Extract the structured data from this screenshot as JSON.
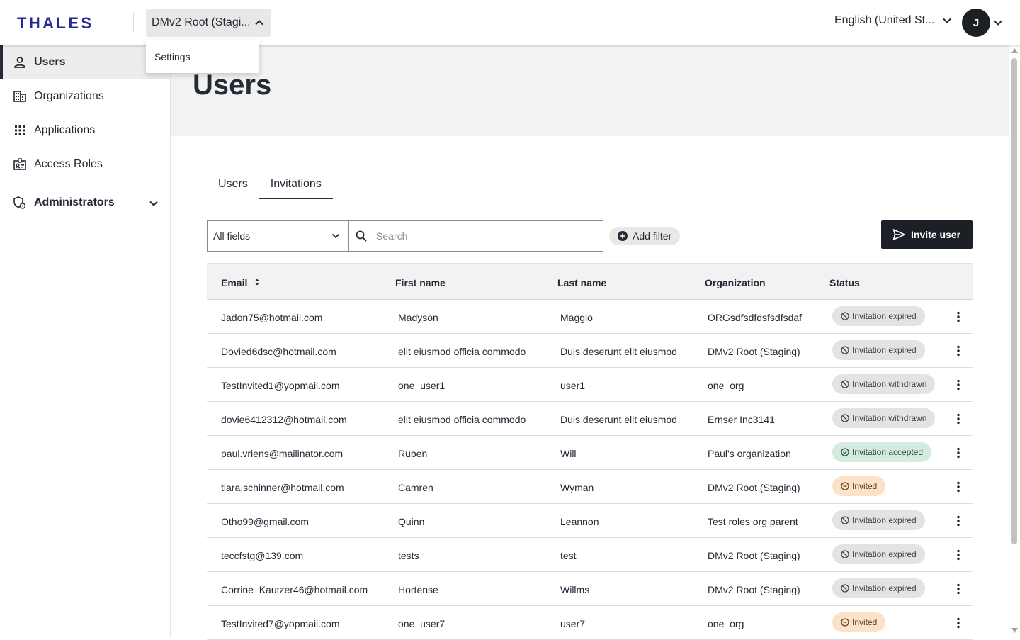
{
  "header": {
    "logo": "THALES",
    "org_selector": "DMv2 Root (Stagi...",
    "language": "English (United St...",
    "avatar_initial": "J"
  },
  "dropdown": {
    "items": [
      "Settings"
    ]
  },
  "sidebar": {
    "items": [
      {
        "label": "Users",
        "icon": "person-icon",
        "active": true
      },
      {
        "label": "Organizations",
        "icon": "building-icon"
      },
      {
        "label": "Applications",
        "icon": "apps-grid-icon"
      },
      {
        "label": "Access Roles",
        "icon": "id-badge-icon"
      },
      {
        "label": "Administrators",
        "icon": "admin-shield-icon",
        "expandable": true
      }
    ]
  },
  "main": {
    "title": "Users",
    "tabs": [
      {
        "label": "Users",
        "active": false
      },
      {
        "label": "Invitations",
        "active": true
      }
    ],
    "filter_field": "All fields",
    "search_placeholder": "Search",
    "add_filter": "Add filter",
    "invite_button": "Invite user"
  },
  "table": {
    "columns": [
      "Email",
      "First name",
      "Last name",
      "Organization",
      "Status"
    ],
    "rows": [
      {
        "email": "Jadon75@hotmail.com",
        "first": "Madyson",
        "last": "Maggio",
        "org": "ORGsdfsdfdsfsdfsdaf",
        "status": "Invitation expired",
        "kind": "expired"
      },
      {
        "email": "Dovied6dsc@hotmail.com",
        "first": "elit eiusmod officia commodo",
        "last": "Duis deserunt elit eiusmod",
        "org": "DMv2 Root (Staging)",
        "status": "Invitation expired",
        "kind": "expired"
      },
      {
        "email": "TestInvited1@yopmail.com",
        "first": "one_user1",
        "last": "user1",
        "org": "one_org",
        "status": "Invitation withdrawn",
        "kind": "withdrawn"
      },
      {
        "email": "dovie6412312@hotmail.com",
        "first": "elit eiusmod officia commodo",
        "last": "Duis deserunt elit eiusmod",
        "org": "Ernser Inc3141",
        "status": "Invitation withdrawn",
        "kind": "withdrawn"
      },
      {
        "email": "paul.vriens@mailinator.com",
        "first": "Ruben",
        "last": "Will",
        "org": "Paul's organization",
        "status": "Invitation accepted",
        "kind": "accepted"
      },
      {
        "email": "tiara.schinner@hotmail.com",
        "first": "Camren",
        "last": "Wyman",
        "org": "DMv2 Root (Staging)",
        "status": "Invited",
        "kind": "invited"
      },
      {
        "email": "Otho99@gmail.com",
        "first": "Quinn",
        "last": "Leannon",
        "org": "Test roles org parent",
        "status": "Invitation expired",
        "kind": "expired"
      },
      {
        "email": "teccfstg@139.com",
        "first": "tests",
        "last": "test",
        "org": "DMv2 Root (Staging)",
        "status": "Invitation expired",
        "kind": "expired"
      },
      {
        "email": "Corrine_Kautzer46@hotmail.com",
        "first": "Hortense",
        "last": "Willms",
        "org": "DMv2 Root (Staging)",
        "status": "Invitation expired",
        "kind": "expired"
      },
      {
        "email": "TestInvited7@yopmail.com",
        "first": "one_user7",
        "last": "user7",
        "org": "one_org",
        "status": "Invited",
        "kind": "invited"
      }
    ]
  },
  "colors": {
    "primary_dark": "#1c1f26",
    "brand_blue": "#242a8e",
    "accepted_bg": "#d6ebe0",
    "invited_bg": "#fbe2c8",
    "neutral_badge_bg": "#e3e3e3"
  }
}
